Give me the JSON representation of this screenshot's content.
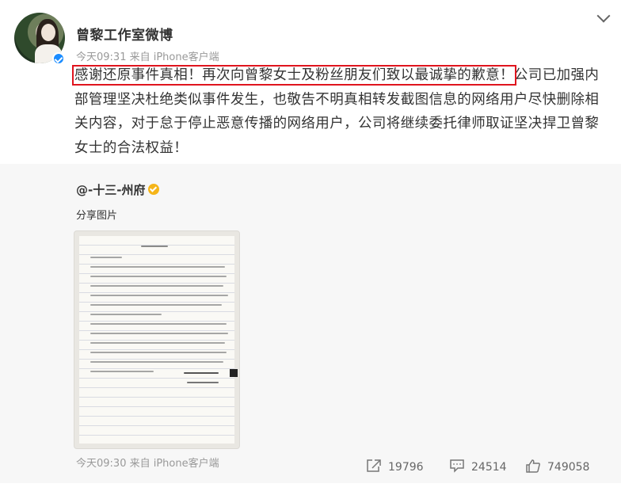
{
  "post": {
    "username": "曾黎工作室微博",
    "meta": "今天09:31  来自 iPhone客户端",
    "highlight": "感谢还原事件真相！再次向曾黎女士及粉丝朋友们致以最诚挚的歉意！",
    "text_rest": "公司已加强内部管理坚决杜绝类似事件发生，也敬告不明真相转发截图信息的网络用户尽快删除相关内容，对于怠于停止恶意传播的网络用户，公司将继续委托律师取证坚决捍卫曾黎女士的合法权益！"
  },
  "repost": {
    "orig_user": "@-十三-州府",
    "share_text": "分享图片",
    "time": "今天09:30 来自 iPhone客户端",
    "forward_count": "19796",
    "comment_count": "24514",
    "like_count": "749058"
  },
  "icons": {
    "more": "chevron-down-icon",
    "verified": "verified-icon",
    "forward": "forward-icon",
    "comment": "comment-icon",
    "like": "like-icon"
  },
  "colors": {
    "highlight_border": "#e0141e",
    "verified_blue": "#1a8cff",
    "verified_gold": "#f5b519"
  }
}
